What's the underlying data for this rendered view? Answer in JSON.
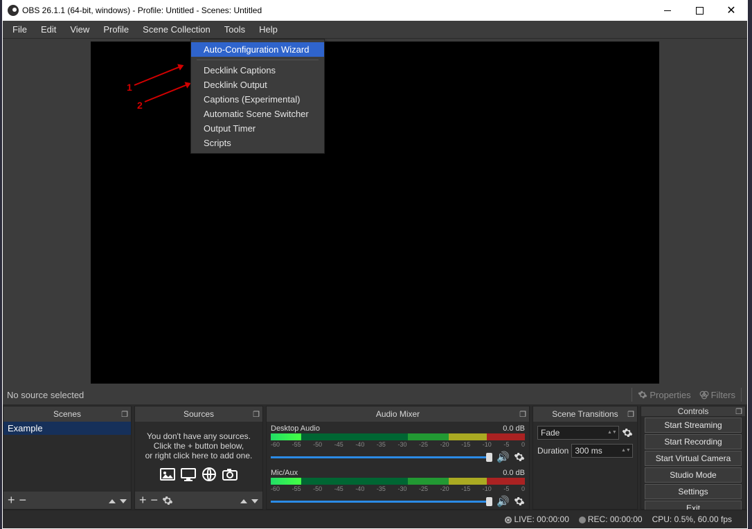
{
  "titlebar": {
    "title": "OBS 26.1.1 (64-bit, windows) - Profile: Untitled - Scenes: Untitled"
  },
  "menu": {
    "items": [
      "File",
      "Edit",
      "View",
      "Profile",
      "Scene Collection",
      "Tools",
      "Help"
    ]
  },
  "tools_menu": {
    "items": [
      "Auto-Configuration Wizard",
      "Decklink Captions",
      "Decklink Output",
      "Captions (Experimental)",
      "Automatic Scene Switcher",
      "Output Timer",
      "Scripts"
    ]
  },
  "annotation": {
    "num1": "1",
    "num2": "2"
  },
  "midbar": {
    "no_source": "No source selected",
    "properties": "Properties",
    "filters": "Filters"
  },
  "panels": {
    "scenes": {
      "title": "Scenes",
      "item": "Example"
    },
    "sources": {
      "title": "Sources",
      "empty1": "You don't have any sources.",
      "empty2": "Click the + button below,",
      "empty3": "or right click here to add one."
    },
    "mixer": {
      "title": "Audio Mixer",
      "desktop": {
        "label": "Desktop Audio",
        "db": "0.0 dB"
      },
      "mic": {
        "label": "Mic/Aux",
        "db": "0.0 dB"
      },
      "ticks": [
        "-60",
        "-55",
        "-50",
        "-45",
        "-40",
        "-35",
        "-30",
        "-25",
        "-20",
        "-15",
        "-10",
        "-5",
        "0"
      ]
    },
    "transitions": {
      "title": "Scene Transitions",
      "fade": "Fade",
      "duration_label": "Duration",
      "duration_value": "300 ms"
    },
    "controls": {
      "title": "Controls",
      "buttons": [
        "Start Streaming",
        "Start Recording",
        "Start Virtual Camera",
        "Studio Mode",
        "Settings",
        "Exit"
      ]
    }
  },
  "status": {
    "live": "LIVE: 00:00:00",
    "rec": "REC: 00:00:00",
    "cpu": "CPU: 0.5%, 60.00 fps"
  }
}
